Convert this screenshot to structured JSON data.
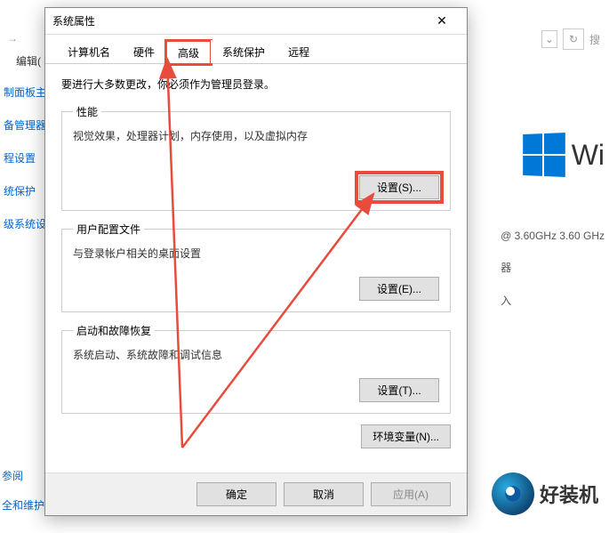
{
  "background": {
    "back_arrow": "→",
    "edit_menu": "编辑(",
    "sidebar_items": [
      "制面板主页",
      "备管理器",
      "程设置",
      "统保护",
      "级系统设置"
    ],
    "win_text": "Wi",
    "cpu_info": "@ 3.60GHz  3.60 GHz",
    "other_info_1": "器",
    "other_info_2": "入",
    "bottom_links": [
      "参阅",
      "全和维护"
    ],
    "search_placeholder": "搜",
    "dropdown_char": "⌄",
    "refresh_char": "↻"
  },
  "dialog": {
    "title": "系统属性",
    "close": "✕",
    "tabs": {
      "computer_name": "计算机名",
      "hardware": "硬件",
      "advanced": "高级",
      "protection": "系统保护",
      "remote": "远程"
    },
    "admin_note": "要进行大多数更改，你必须作为管理员登录。",
    "perf": {
      "legend": "性能",
      "desc": "视觉效果，处理器计划，内存使用，以及虚拟内存",
      "button": "设置(S)..."
    },
    "profile": {
      "legend": "用户配置文件",
      "desc": "与登录帐户相关的桌面设置",
      "button": "设置(E)..."
    },
    "startup": {
      "legend": "启动和故障恢复",
      "desc": "系统启动、系统故障和调试信息",
      "button": "设置(T)..."
    },
    "env_button": "环境变量(N)...",
    "ok": "确定",
    "cancel": "取消",
    "apply": "应用(A)"
  },
  "watermark": {
    "text": "好装机"
  }
}
